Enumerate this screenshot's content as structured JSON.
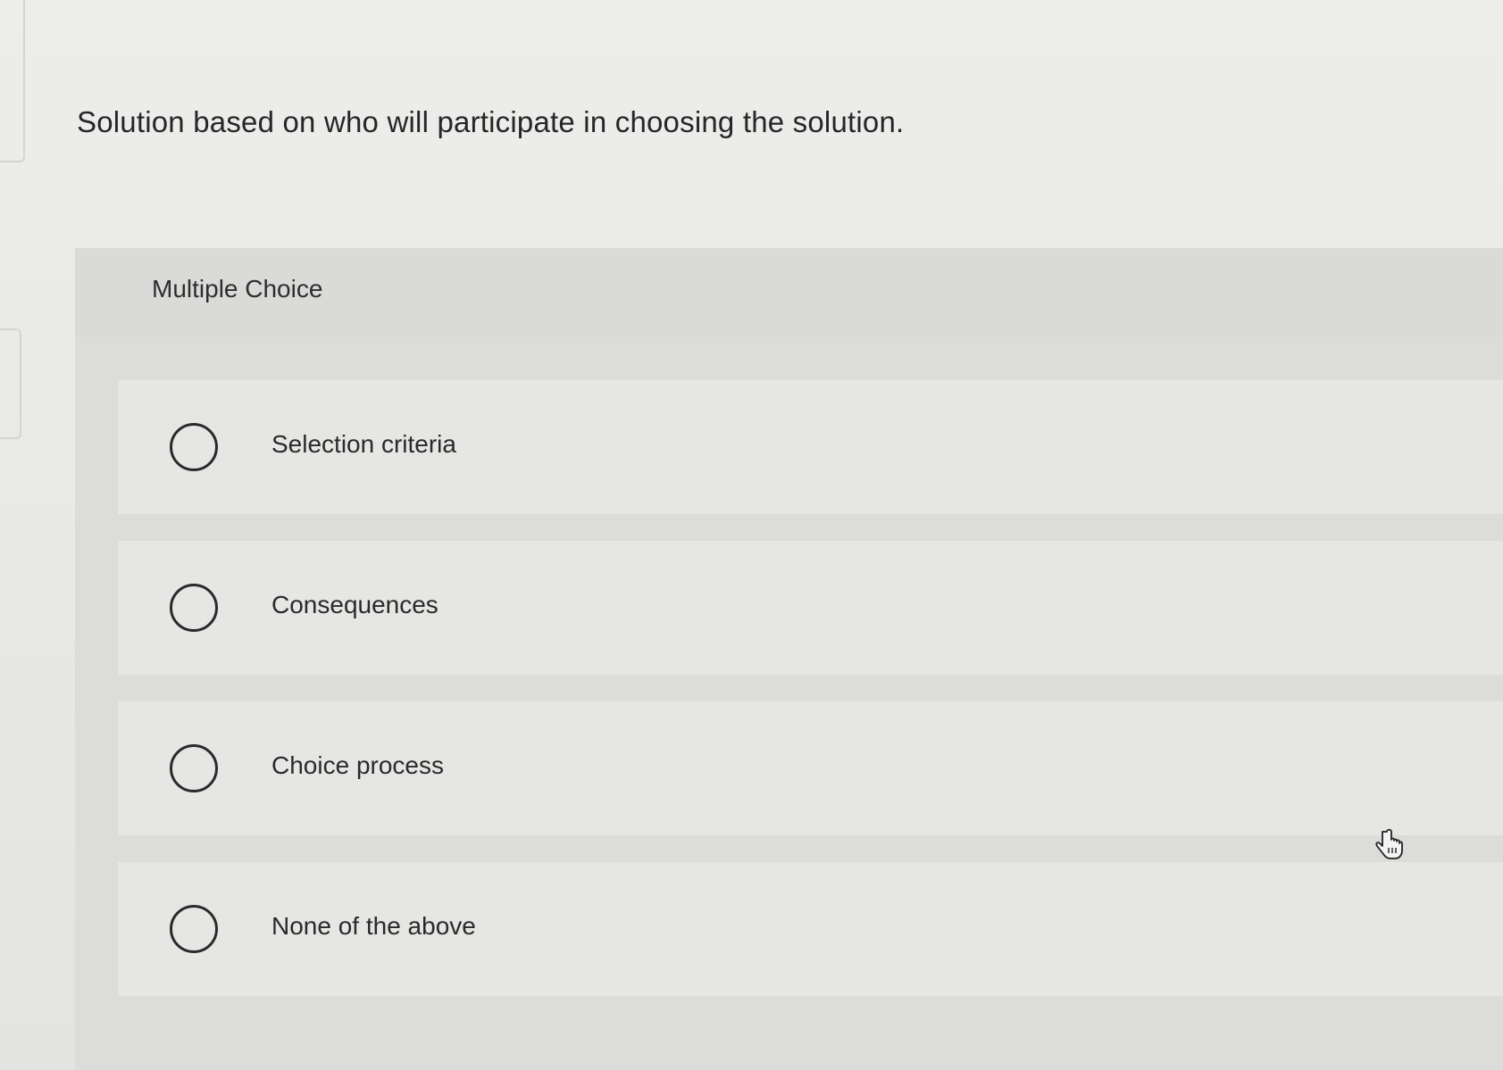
{
  "question": {
    "text": "Solution based on who will participate in choosing the solution."
  },
  "multiple_choice": {
    "label": "Multiple Choice",
    "options": [
      {
        "label": "Selection criteria",
        "selected": false
      },
      {
        "label": "Consequences",
        "selected": false
      },
      {
        "label": "Choice process",
        "selected": false
      },
      {
        "label": "None of the above",
        "selected": false
      }
    ]
  },
  "icons": {
    "cursor": "hand-pointer-icon",
    "radio": "radio-unselected-icon"
  },
  "colors": {
    "background": "#e9e9e7",
    "panel": "#dcdcda",
    "option_background": "#e6e6e4",
    "text": "#2a2a2a"
  }
}
